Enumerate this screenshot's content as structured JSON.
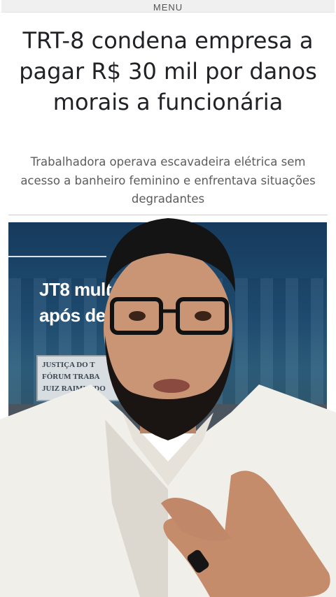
{
  "menu": {
    "label": "MENU"
  },
  "article": {
    "headline": "TRT-8 condena empresa a pagar R$ 30 mil por danos morais a funcionária",
    "subheadline": "Trabalhadora operava escavadeira elétrica sem acesso a banheiro feminino e enfrentava situações degradantes"
  },
  "thumbnail": {
    "title_partial": "JT8 mult                     $30 mil\napós de                          inação",
    "sign_lines": [
      "JUSTIÇA DO T",
      "FÓRUM TRABA",
      "JUIZ RAIMUNDO"
    ]
  },
  "caption": {
    "hashtag": "#"
  },
  "colors": {
    "headline": "#202226",
    "subheadline": "#5c5c5c",
    "thumbnail_bg": "#1f4e74",
    "shirt": "#f1efea",
    "hair": "#141414"
  },
  "overlay": {
    "presenter": "person-video-overlay"
  }
}
